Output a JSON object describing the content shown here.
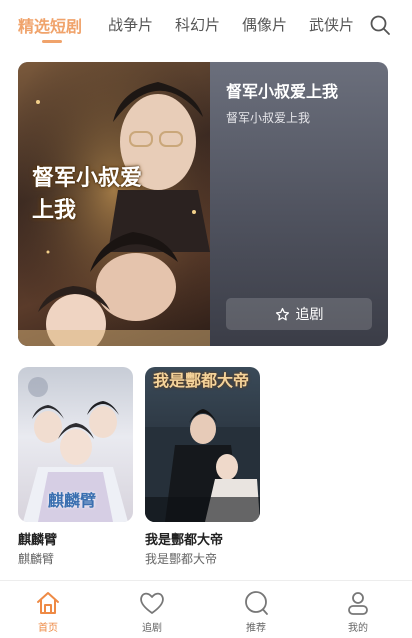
{
  "tabs": [
    {
      "label": "精选短剧",
      "active": true
    },
    {
      "label": "战争片",
      "active": false
    },
    {
      "label": "科幻片",
      "active": false
    },
    {
      "label": "偶像片",
      "active": false
    },
    {
      "label": "武侠片",
      "active": false
    }
  ],
  "search": {
    "icon": "search-icon"
  },
  "featured": {
    "title": "督军小叔爱上我",
    "subtitle": "督军小叔爱上我",
    "poster_text": "督军小叔爱上我",
    "follow_label": "追剧",
    "follow_icon": "star-icon"
  },
  "dramas": [
    {
      "name": "麒麟臂",
      "subtitle": "麒麟臂",
      "poster_text": "麒麟臂"
    },
    {
      "name": "我是酆都大帝",
      "subtitle": "我是酆都大帝",
      "poster_text": "我是酆都大帝"
    }
  ],
  "nav": [
    {
      "label": "首页",
      "icon": "home-icon",
      "active": true
    },
    {
      "label": "追剧",
      "icon": "heart-icon",
      "active": false
    },
    {
      "label": "推荐",
      "icon": "compass-icon",
      "active": false
    },
    {
      "label": "我的",
      "icon": "user-icon",
      "active": false
    }
  ],
  "colors": {
    "accent": "#f0a36b",
    "nav_active": "#ee8a45",
    "card_bg": "#4f525e"
  }
}
